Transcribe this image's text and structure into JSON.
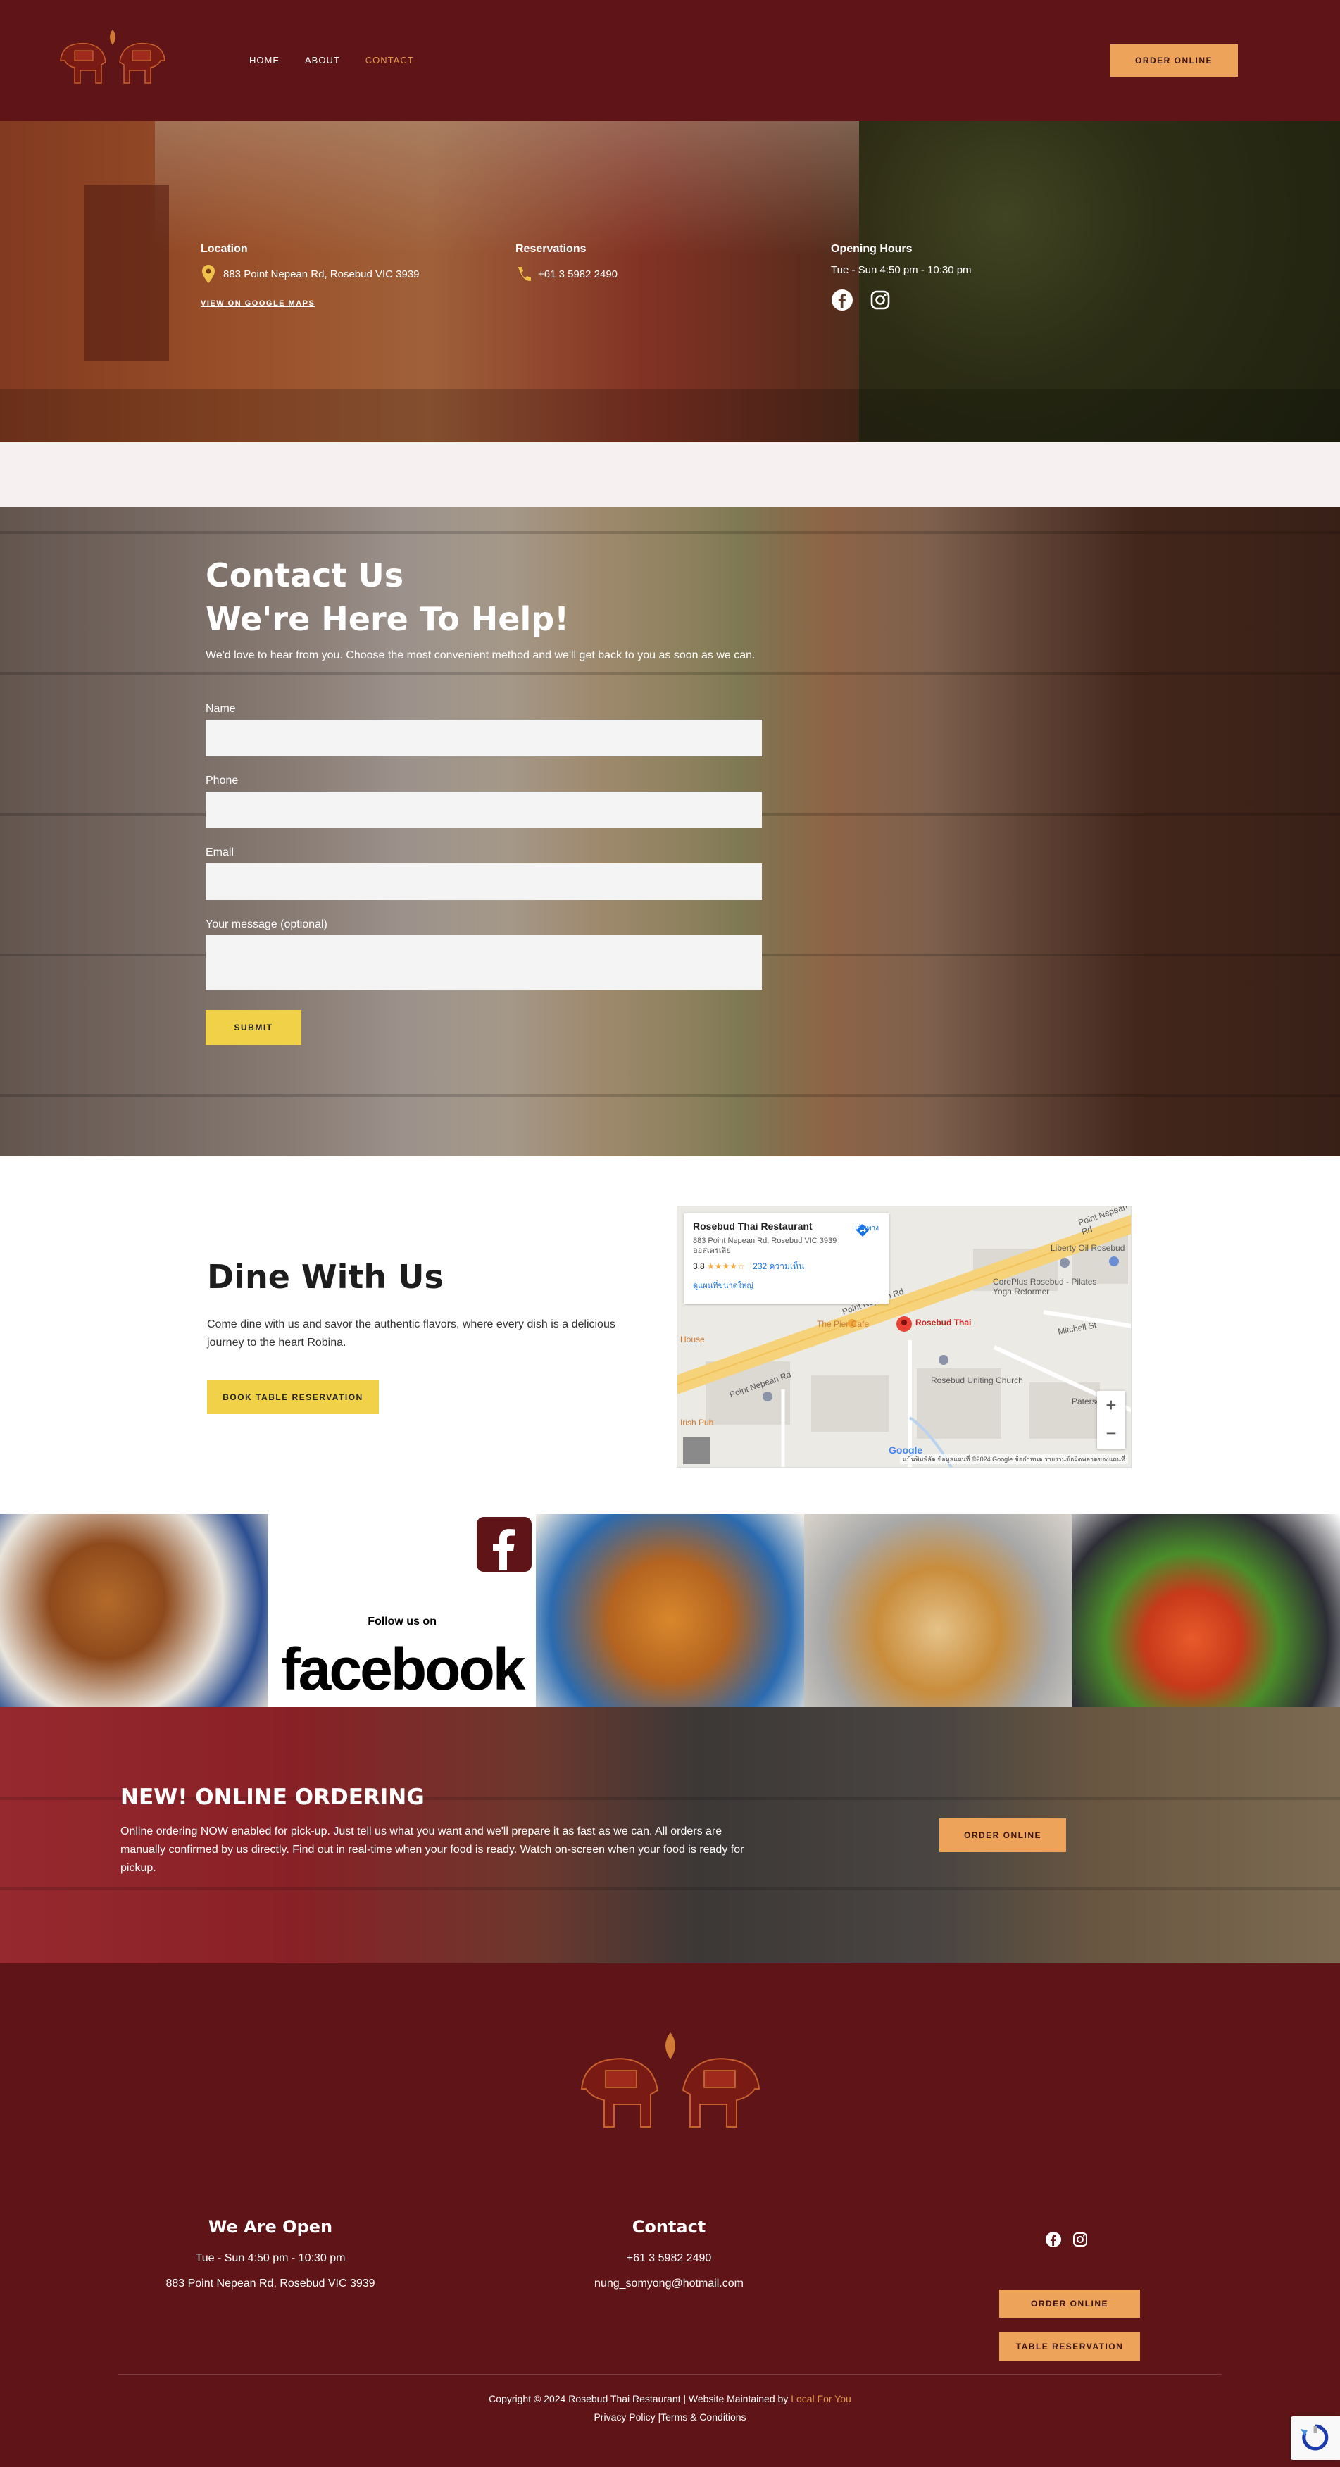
{
  "header": {
    "nav": [
      {
        "label": "HOME"
      },
      {
        "label": "ABOUT"
      },
      {
        "label": "CONTACT",
        "active": true
      }
    ],
    "order_button": "ORDER ONLINE"
  },
  "hero": {
    "location": {
      "title": "Location",
      "address": "883 Point Nepean Rd, Rosebud VIC 3939",
      "link": "VIEW ON GOOGLE MAPS"
    },
    "reservations": {
      "title": "Reservations",
      "phone": "+61 3 5982 2490"
    },
    "hours": {
      "title": "Opening Hours",
      "text": "Tue - Sun 4:50 pm - 10:30 pm",
      "social": [
        "facebook-icon",
        "instagram-icon"
      ]
    }
  },
  "contact": {
    "title_line1": "Contact Us",
    "title_line2": "We're Here To Help!",
    "subtitle": "We'd love to hear from you. Choose the most convenient method and we'll get back to you as soon as we can.",
    "fields": [
      {
        "label": "Name"
      },
      {
        "label": "Phone"
      },
      {
        "label": "Email"
      },
      {
        "label": "Your message (optional)"
      }
    ],
    "submit": "SUBMIT"
  },
  "dine": {
    "title": "Dine With Us",
    "text": "Come dine with us and savor the authentic flavors, where every dish is a delicious journey to the heart Robina.",
    "button": "BOOK TABLE RESERVATION",
    "map": {
      "name": "Rosebud Thai Restaurant",
      "address": "883 Point Nepean Rd, Rosebud VIC 3939 ออสเตรเลีย",
      "rating": "3.8",
      "stars": "★★★★☆",
      "reviews": "232 ความเห็น",
      "larger_map": "ดูแผนที่ขนาดใหญ่",
      "directions": "เส้นทาง",
      "pin_label": "Rosebud Thai",
      "labels": [
        "Point Nepean Rd",
        "Point Nepean Rd",
        "Point Nepean Rd",
        "Liberty Oil Rosebud",
        "CorePlus Rosebud - Pilates Yoga Reformer",
        "The Pier Cafe",
        "Rosebud Uniting Church",
        "Mitchell St",
        "Paterson St",
        "Irish Pub",
        "House"
      ],
      "credits": "แป้นพิมพ์ลัด   ข้อมูลแผนที่ ©2024 Google   ข้อกำหนด   รายงานข้อผิดพลาดของแผนที่",
      "google": "Google",
      "zoom_in": "+",
      "zoom_out": "−"
    }
  },
  "strip": {
    "follow": "Follow us on",
    "facebook_word": "facebook"
  },
  "online": {
    "title": "NEW! ONLINE ORDERING",
    "text": "Online ordering NOW enabled for pick-up. Just tell us what you want and we'll prepare it as fast as we can. All orders are manually confirmed by us directly. Find out in real-time when your food is ready. Watch on-screen when your food is ready for pickup.",
    "button": "ORDER ONLINE"
  },
  "footer": {
    "open": {
      "title": "We Are Open",
      "hours": "Tue - Sun 4:50 pm - 10:30 pm",
      "address": "883 Point Nepean Rd, Rosebud VIC 3939"
    },
    "contact": {
      "title": "Contact",
      "phone": "+61 3 5982 2490",
      "email": "nung_somyong@hotmail.com"
    },
    "buttons": [
      "ORDER ONLINE",
      "TABLE RESERVATION"
    ],
    "copyright": "Copyright © 2024 Rosebud Thai Restaurant | Website Maintained by",
    "maintainer": "Local For You",
    "privacy": "Privacy Policy",
    "separator": " |",
    "terms": "Terms & Conditions"
  },
  "colors": {
    "maroon": "#5f1518",
    "orange_button": "#eea35b",
    "yellow_button": "#f0d148",
    "active_nav": "#e39a4c"
  }
}
